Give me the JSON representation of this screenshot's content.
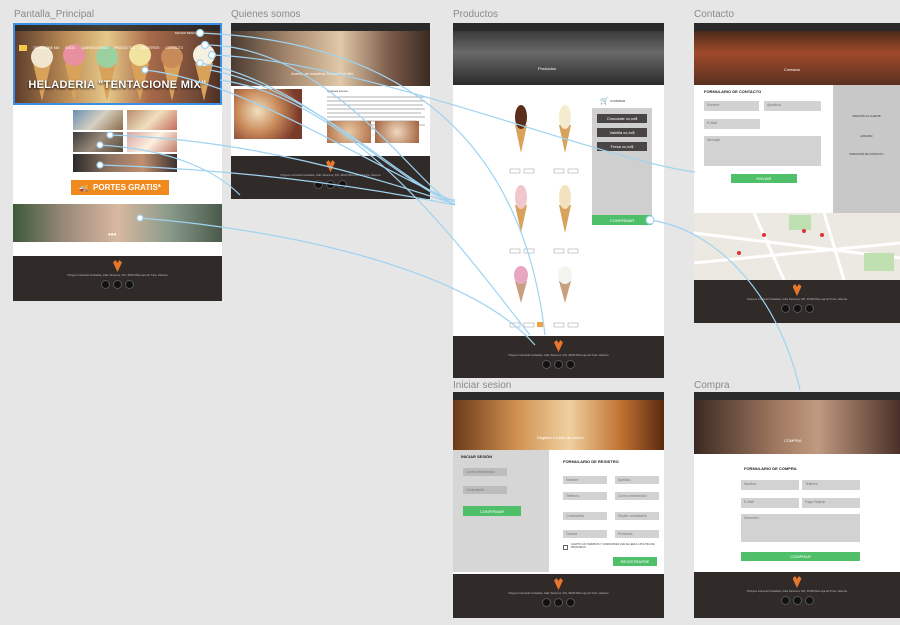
{
  "frames": {
    "principal": "Pantalla_Principal",
    "quienes": "Quienes somos",
    "productos": "Productos",
    "contacto": "Contacto",
    "iniciar": "Iniciar sesion",
    "compra": "Compra"
  },
  "principal": {
    "hero_title": "HELADERIA \"TENTACIONE MIX\"",
    "portes": "PORTES GRATIS*",
    "dots": "•••",
    "nav": [
      "TENTAZIONE MIX",
      "INICIO",
      "QUIENES SOMOS",
      "PRODUCTOS",
      "REGISTROS",
      "CONTACTO"
    ],
    "login": "INICIAR SESION"
  },
  "quienes": {
    "banner": "Acerca de nosotros Tentazione Mix",
    "section": "Quienes somos"
  },
  "productos": {
    "banner": "Productos",
    "cart": "COMPRAR",
    "prices": [
      "Chocolate xx,xx$",
      "Vainilla xx,xx$",
      "Fresa xx,xx$"
    ],
    "confirm": "CONFIRMAR"
  },
  "contacto": {
    "banner": "Contacto",
    "form_title": "FORMULARIO DE CONTACTO",
    "name": "Nombre",
    "surname": "Apellidos",
    "email": "E-Mail",
    "message": "Mensaje",
    "send": "ENVIAR",
    "side_titles": [
      "ATENCIÓN AL CLIENTE",
      "HORARIO",
      "DIRECCIÓN DE CONTACTO"
    ]
  },
  "iniciar": {
    "banner": "Registro e inicio de sesión",
    "login_title": "INICIAR SESIÓN",
    "user": "Correo electrónico",
    "password": "Contraseña",
    "login_btn": "CONFIRMAR",
    "register_title": "FORMULARIO DE REGISTRO",
    "fields": [
      "Nombre",
      "Apellido",
      "Teléfono",
      "Correo electrónico",
      "Contraseña",
      "Repite contraseña",
      "Ciudad",
      "Provincia"
    ],
    "terms": "ACEPTO LOS TÉRMINOS Y CONDICIONES QUE SE LEEN LA POLÍTICA DE PRIVACIDAD",
    "register_btn": "REGISTRARSE"
  },
  "compra": {
    "banner": "COMPRA",
    "form_title": "FORMULARIO DE COMPRA",
    "name": "Nombre",
    "phone": "Teléfono",
    "email": "E-Mail",
    "payment": "Pago/Tarjeta",
    "address": "Dirección",
    "confirm": "COMPRAR"
  },
  "footer_text": "Polígono Industrial Ciudadela, Calle Tarazona, S/N, 46183 Riba-roja del Turia, Valencia"
}
